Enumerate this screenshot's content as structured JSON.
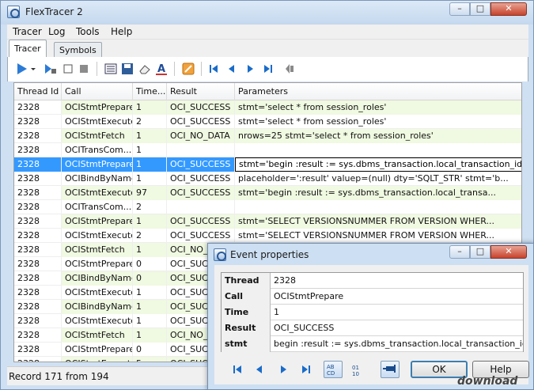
{
  "window": {
    "title": "FlexTracer 2"
  },
  "menu": [
    "Tracer",
    "Log",
    "Tools",
    "Help"
  ],
  "tabs": [
    "Tracer",
    "Symbols"
  ],
  "grid": {
    "columns": [
      "Thread Id",
      "Call",
      "Time...",
      "Result",
      "Parameters"
    ],
    "rows": [
      [
        "2328",
        "OCIStmtPrepare",
        "1",
        "OCI_SUCCESS",
        "stmt='select * from session_roles'"
      ],
      [
        "2328",
        "OCIStmtExecute",
        "2",
        "OCI_SUCCESS",
        "stmt='select * from session_roles'"
      ],
      [
        "2328",
        "OCIStmtFetch",
        "1",
        "OCI_NO_DATA",
        "nrows=25 stmt='select * from session_roles'"
      ],
      [
        "2328",
        "OCITransCom...",
        "1",
        "",
        ""
      ],
      [
        "2328",
        "OCIStmtPrepare",
        "1",
        "OCI_SUCCESS",
        "stmt='begin  :result := sys.dbms_transaction.local_transaction_id(true); end;'"
      ],
      [
        "2328",
        "OCIBindByName",
        "1",
        "OCI_SUCCESS",
        "placeholder=':result' valuep=(null) dty='SQLT_STR' stmt='b..."
      ],
      [
        "2328",
        "OCIStmtExecute",
        "97",
        "OCI_SUCCESS",
        "stmt='begin  :result := sys.dbms_transaction.local_transa..."
      ],
      [
        "2328",
        "OCITransCom...",
        "2",
        "",
        ""
      ],
      [
        "2328",
        "OCIStmtPrepare",
        "1",
        "OCI_SUCCESS",
        "stmt='SELECT VERSIONSNUMMER FROM VERSION WHER..."
      ],
      [
        "2328",
        "OCIStmtExecute",
        "2",
        "OCI_SUCCESS",
        "stmt='SELECT VERSIONSNUMMER FROM VERSION WHER..."
      ],
      [
        "2328",
        "OCIStmtFetch",
        "1",
        "OCI_NO_",
        ""
      ],
      [
        "2328",
        "OCIStmtPrepare",
        "0",
        "OCI_SUCC",
        ""
      ],
      [
        "2328",
        "OCIBindByName",
        "0",
        "OCI_SUC",
        ""
      ],
      [
        "2328",
        "OCIStmtExecute",
        "1",
        "OCI_SUC",
        ""
      ],
      [
        "2328",
        "OCIBindByName",
        "1",
        "OCI_SUC",
        ""
      ],
      [
        "2328",
        "OCIStmtExecute",
        "1",
        "OCI_SUC",
        ""
      ],
      [
        "2328",
        "OCIStmtFetch",
        "1",
        "OCI_NO_",
        ""
      ],
      [
        "2328",
        "OCIStmtPrepare",
        "0",
        "OCI_SUC",
        ""
      ],
      [
        "2328",
        "OCIStmtExecute",
        "5",
        "OCI_SUC",
        ""
      ]
    ],
    "selected_row": 4
  },
  "status": {
    "text": "Record 171 from 194"
  },
  "dialog": {
    "title": "Event properties",
    "properties": [
      {
        "key": "Thread Id",
        "value": "2328"
      },
      {
        "key": "Call",
        "value": "OCIStmtPrepare"
      },
      {
        "key": "Time (ms)",
        "value": "1"
      },
      {
        "key": "Result",
        "value": "OCI_SUCCESS"
      },
      {
        "key": "stmt",
        "value": "begin  :result := sys.dbms_transaction.local_transaction_id(true);"
      }
    ],
    "ok_label": "OK",
    "help_label": "Help",
    "toggle_binary": "01\n10"
  },
  "watermark": "download",
  "colors": {
    "row_highlight": "#f0f9e1",
    "selection": "#3399ff",
    "accent": "#1a6cc9"
  }
}
